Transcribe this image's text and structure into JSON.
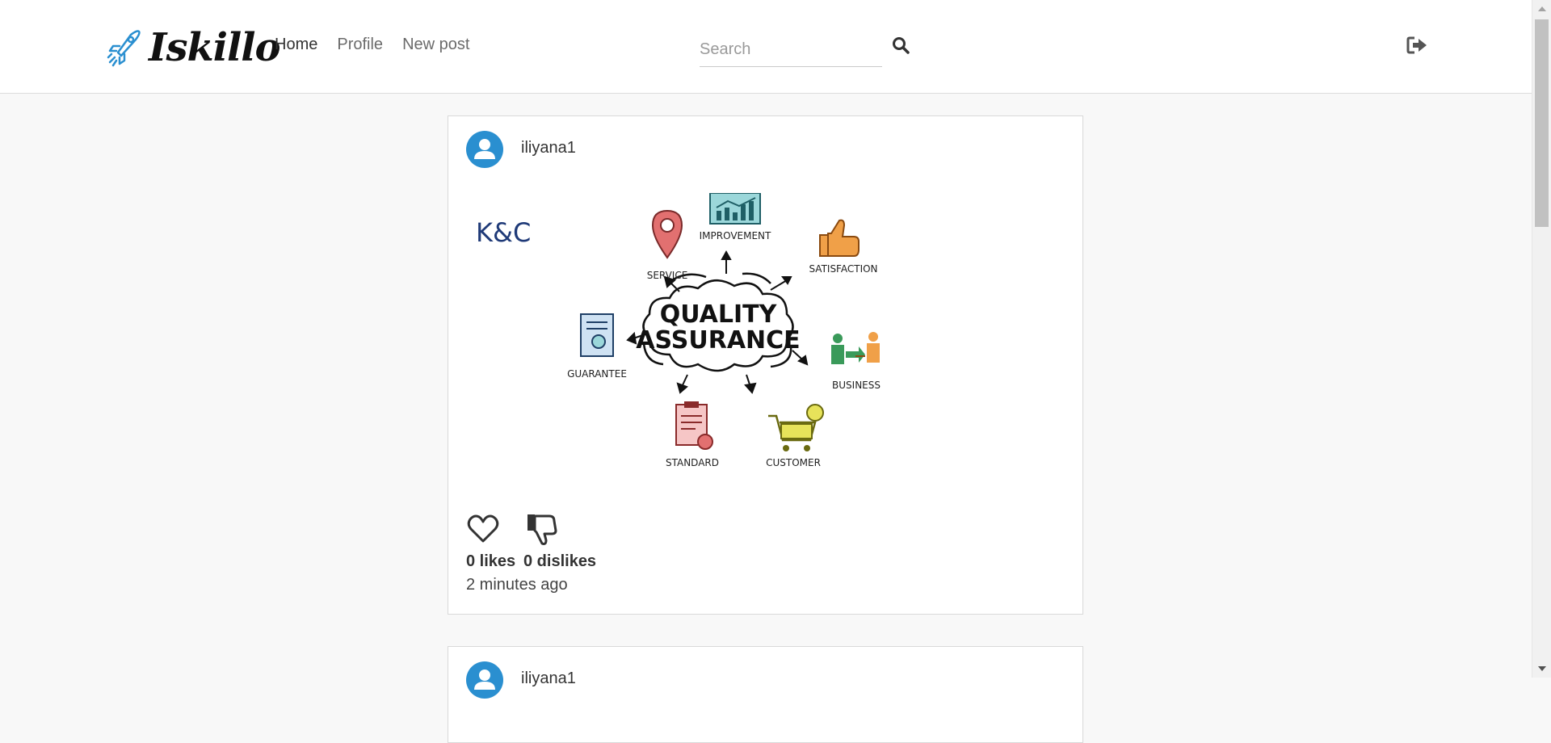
{
  "brand": {
    "name": "Iskillo"
  },
  "nav": {
    "links": [
      {
        "label": "Home",
        "active": true
      },
      {
        "label": "Profile",
        "active": false
      },
      {
        "label": "New post",
        "active": false
      }
    ]
  },
  "search": {
    "placeholder": "Search",
    "value": ""
  },
  "icons": {
    "search": "search-icon",
    "logout": "sign-out-icon",
    "like": "heart-outline-icon",
    "dislike": "thumbs-down-icon",
    "avatar": "user-avatar-icon"
  },
  "colors": {
    "accent": "#2a8fd0",
    "text": "#333333",
    "background": "#f8f8f8"
  },
  "posts": [
    {
      "username": "iliyana1",
      "image": {
        "corner_text": "K&C",
        "title_line1": "QUALITY",
        "title_line2": "ASSURANCE",
        "labels": {
          "improvement": "IMPROVEMENT",
          "service": "SERVICE",
          "satisfaction": "SATISFACTION",
          "guarantee": "GUARANTEE",
          "business": "BUSINESS",
          "standard": "STANDARD",
          "customer": "CUSTOMER"
        }
      },
      "likes_text": "0 likes",
      "dislikes_text": "0 dislikes",
      "time_text": "2 minutes ago"
    },
    {
      "username": "iliyana1"
    }
  ]
}
